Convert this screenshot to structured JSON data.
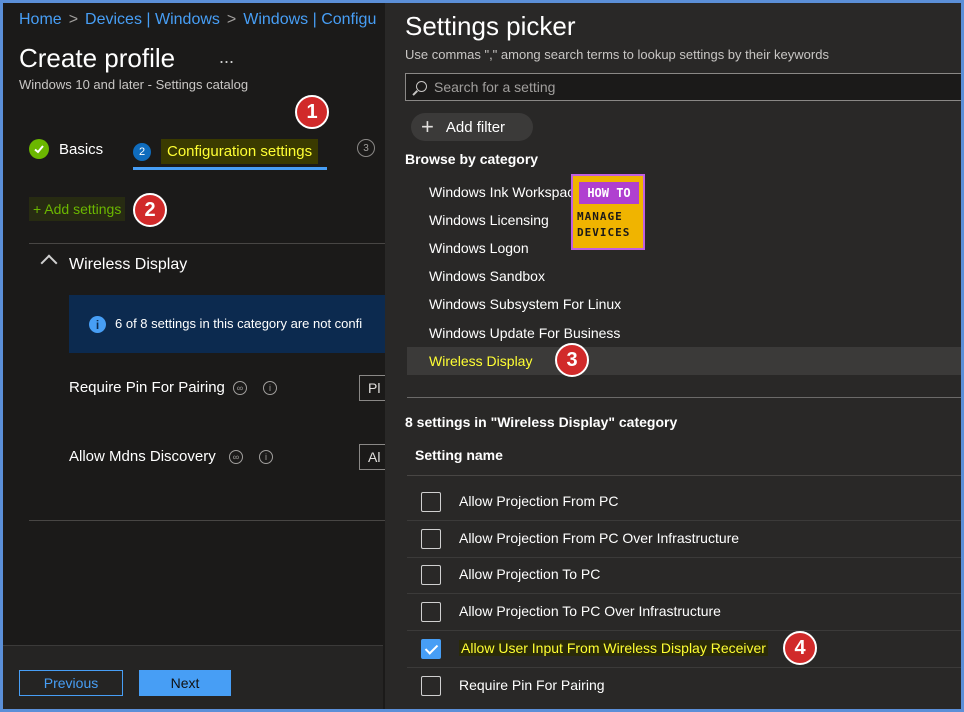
{
  "breadcrumb": [
    "Home",
    "Devices | Windows",
    "Windows | Configu"
  ],
  "page": {
    "title": "Create profile",
    "more": "...",
    "subtitle": "Windows 10 and later - Settings catalog"
  },
  "steps": [
    {
      "label": "Basics",
      "state": "done"
    },
    {
      "number": "2",
      "label": "Configuration settings",
      "state": "current"
    },
    {
      "number": "3",
      "label": "",
      "state": "upcoming"
    }
  ],
  "add_settings": "+ Add settings",
  "section": {
    "title": "Wireless Display",
    "info": "6 of 8 settings in this category are not confi",
    "settings": [
      {
        "label": "Require Pin For Pairing",
        "value": "Pl"
      },
      {
        "label": "Allow Mdns Discovery",
        "value": "Al"
      }
    ]
  },
  "footer": {
    "previous": "Previous",
    "next": "Next"
  },
  "picker": {
    "title": "Settings picker",
    "hint": "Use commas \",\" among search terms to lookup settings by their keywords",
    "search_placeholder": "Search for a setting",
    "add_filter": "Add filter",
    "browse_label": "Browse by category",
    "categories": [
      "Windows Ink Workspace",
      "Windows Licensing",
      "Windows Logon",
      "Windows Sandbox",
      "Windows Subsystem For Linux",
      "Windows Update For Business",
      "Wireless Display"
    ],
    "selected_category": "Wireless Display",
    "count_label": "8 settings in \"Wireless Display\" category",
    "column_header": "Setting name",
    "settings": [
      {
        "label": "Allow Projection From PC",
        "checked": false
      },
      {
        "label": "Allow Projection From PC Over Infrastructure",
        "checked": false
      },
      {
        "label": "Allow Projection To PC",
        "checked": false
      },
      {
        "label": "Allow Projection To PC Over Infrastructure",
        "checked": false
      },
      {
        "label": "Allow User Input From Wireless Display Receiver",
        "checked": true
      },
      {
        "label": "Require Pin For Pairing",
        "checked": false
      }
    ]
  },
  "logo": {
    "line1": "HOW TO",
    "line2": "MANAGE",
    "line3": "DEVICES"
  },
  "callouts": [
    "1",
    "2",
    "3",
    "4"
  ],
  "colors": {
    "accent": "#479ef5",
    "highlight": "#ffff33",
    "callout": "#d12a2a",
    "success": "#6bb700"
  }
}
